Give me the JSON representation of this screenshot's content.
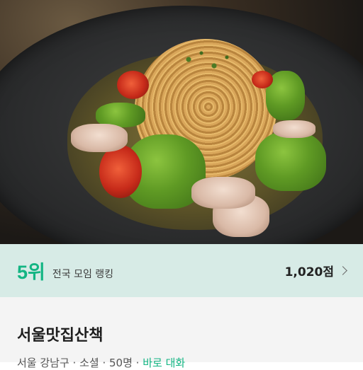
{
  "hero": {
    "image_icon": "pasta-photo"
  },
  "ranking": {
    "rank": "5위",
    "label": "전국 모임 랭킹",
    "score": "1,020점"
  },
  "group": {
    "name": "서울맛집산책",
    "location": "서울 강남구",
    "separator1": " · ",
    "category": "소셜",
    "separator2": " · ",
    "members": "50명",
    "separator3": " · ",
    "status": "바로 대화"
  },
  "colors": {
    "accent": "#13b583",
    "rank_bar_bg": "#d7ebe6"
  }
}
